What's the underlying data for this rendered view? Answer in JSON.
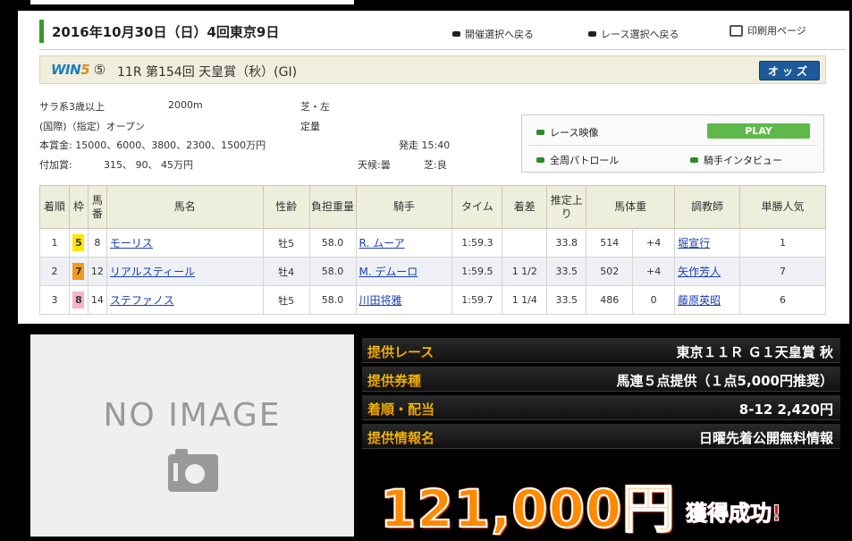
{
  "header": {
    "date": "2016年10月30日（日）4回東京9日",
    "links": [
      "開催選択へ戻る",
      "レース選択へ戻る",
      "印刷用ページ"
    ]
  },
  "race": {
    "logo": "WIN5",
    "win5_leg": "⑤",
    "title": "11R 第154回 天皇賞（秋）(GI)",
    "odds_label": "オッズ"
  },
  "info": {
    "class": "サラ系3歳以上",
    "distance": "2000m",
    "surface": "芝・左",
    "condition": "(国際)（指定）オープン",
    "weight_rule": "定量",
    "prize": "本賞金: 15000、6000、3800、2300、1500万円",
    "post_time": "発走 15:40",
    "added_label": "付加賞:",
    "added_values": "315、 90、 45万円",
    "weather": "天候:曇",
    "going": "芝:良"
  },
  "media": {
    "race_video": "レース映像",
    "play": "PLAY",
    "patrol": "全周パトロール",
    "interview": "騎手インタビュー"
  },
  "table": {
    "headers": [
      "着順",
      "枠",
      "馬番",
      "馬名",
      "性齢",
      "負担重量",
      "騎手",
      "タイム",
      "着差",
      "推定上り",
      "馬体重",
      "",
      "調教師",
      "単勝人気"
    ],
    "rows": [
      {
        "pos": "1",
        "waku": "5",
        "waku_color": "#ffe600",
        "num": "8",
        "horse": "モーリス",
        "sex_age": "牡5",
        "weight": "58.0",
        "jockey": "R. ムーア",
        "time": "1:59.3",
        "margin": "",
        "last3f": "33.8",
        "body": "514",
        "diff": "+4",
        "trainer": "堀宣行",
        "pop": "1"
      },
      {
        "pos": "2",
        "waku": "7",
        "waku_color": "#f39a1e",
        "num": "12",
        "horse": "リアルスティール",
        "sex_age": "牡4",
        "weight": "58.0",
        "jockey": "M. デムーロ",
        "time": "1:59.5",
        "margin": "1 1/2",
        "last3f": "33.5",
        "body": "502",
        "diff": "+4",
        "trainer": "矢作芳人",
        "pop": "7"
      },
      {
        "pos": "3",
        "waku": "8",
        "waku_color": "#f6b4c8",
        "num": "14",
        "horse": "ステファノス",
        "sex_age": "牡5",
        "weight": "58.0",
        "jockey": "川田将雅",
        "time": "1:59.7",
        "margin": "1 1/4",
        "last3f": "33.5",
        "body": "486",
        "diff": "0",
        "trainer": "藤原英昭",
        "pop": "6"
      }
    ]
  },
  "noimage": "NO IMAGE",
  "promo": {
    "rows": [
      {
        "label": "提供レース",
        "value": "東京１１Ｒ Ｇ１天皇賞 秋"
      },
      {
        "label": "提供券種",
        "value": "馬連５点提供（１点5,000円推奨）"
      },
      {
        "label": "着順・配当",
        "value": "8-12 2,420円"
      },
      {
        "label": "提供情報名",
        "value": "日曜先着公開無料情報"
      }
    ],
    "amount": "121,000円",
    "success": "獲得成功!"
  }
}
